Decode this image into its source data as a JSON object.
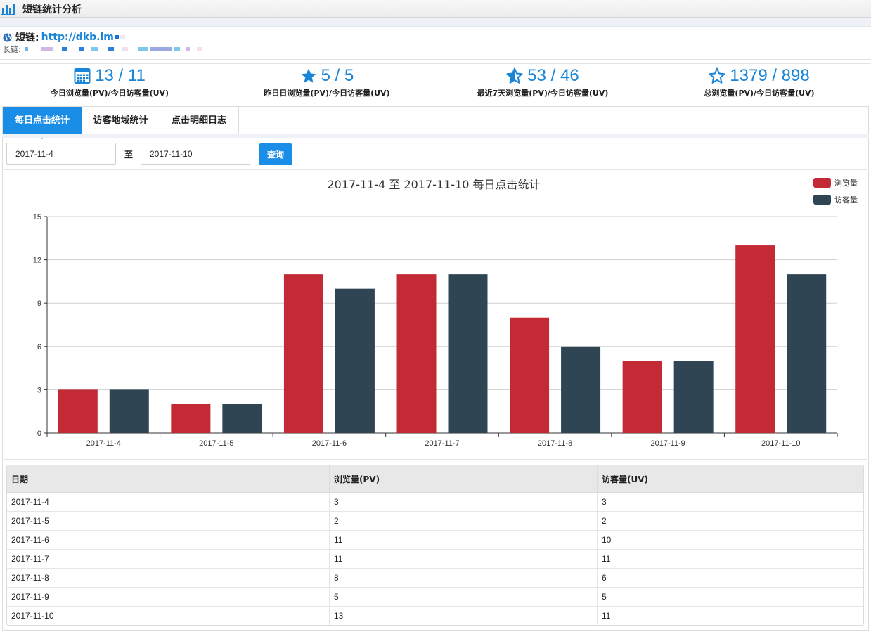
{
  "header": {
    "title": "短链统计分析"
  },
  "link": {
    "short_label": "短链:",
    "short_url": "http://dkb.im",
    "long_label": "长链:"
  },
  "stats": [
    {
      "icon": "calendar-icon",
      "value": "13 / 11",
      "label": "今日浏览量(PV)/今日访客量(UV)"
    },
    {
      "icon": "star-filled-icon",
      "value": "5 / 5",
      "label": "昨日日浏览量(PV)/今日访客量(UV)"
    },
    {
      "icon": "star-half-icon",
      "value": "53 / 46",
      "label": "最近7天浏览量(PV)/今日访客量(UV)"
    },
    {
      "icon": "star-outline-icon",
      "value": "1379 / 898",
      "label": "总浏览量(PV)/今日访客量(UV)"
    }
  ],
  "tabs": [
    {
      "label": "每日点击统计",
      "active": true
    },
    {
      "label": "访客地域统计",
      "active": false
    },
    {
      "label": "点击明细日志",
      "active": false
    }
  ],
  "filter": {
    "start_date": "2017-11-4",
    "to_label": "至",
    "end_date": "2017-11-10",
    "query_label": "查询"
  },
  "colors": {
    "accent": "#1a8ee6",
    "pv": "#c42a35",
    "uv": "#2f4554"
  },
  "chart_data": {
    "type": "bar",
    "title": "2017-11-4 至 2017-11-10 每日点击统计",
    "categories": [
      "2017-11-4",
      "2017-11-5",
      "2017-11-6",
      "2017-11-7",
      "2017-11-8",
      "2017-11-9",
      "2017-11-10"
    ],
    "series": [
      {
        "name": "浏览量",
        "color": "#c42a35",
        "values": [
          3,
          2,
          11,
          11,
          8,
          5,
          13
        ]
      },
      {
        "name": "访客量",
        "color": "#2f4554",
        "values": [
          3,
          2,
          10,
          11,
          6,
          5,
          11
        ]
      }
    ],
    "ylim": [
      0,
      15
    ],
    "yticks": [
      0,
      3,
      6,
      9,
      12,
      15
    ],
    "grid": true,
    "legend_position": "top-right"
  },
  "table": {
    "headers": [
      "日期",
      "浏览量(PV)",
      "访客量(UV)"
    ],
    "rows": [
      [
        "2017-11-4",
        "3",
        "3"
      ],
      [
        "2017-11-5",
        "2",
        "2"
      ],
      [
        "2017-11-6",
        "11",
        "10"
      ],
      [
        "2017-11-7",
        "11",
        "11"
      ],
      [
        "2017-11-8",
        "8",
        "6"
      ],
      [
        "2017-11-9",
        "5",
        "5"
      ],
      [
        "2017-11-10",
        "13",
        "11"
      ]
    ]
  }
}
